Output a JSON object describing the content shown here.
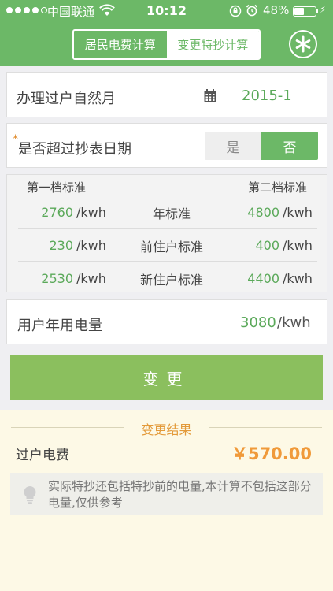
{
  "status_bar": {
    "carrier": "中国联通",
    "time": "10:12",
    "battery": "48%",
    "battery_level": 0.48
  },
  "nav": {
    "tabs": [
      {
        "label": "居民电费计算",
        "active": false
      },
      {
        "label": "变更特抄计算",
        "active": true
      }
    ],
    "action_icon": "asterisk-icon"
  },
  "form": {
    "transfer_month": {
      "label": "办理过户自然月",
      "value": "2015-1",
      "icon": "calendar-icon"
    },
    "over_read_date": {
      "label": "是否超过抄表日期",
      "required_mark": "*",
      "options": [
        "是",
        "否"
      ],
      "selected": "否"
    }
  },
  "standards": {
    "header_left": "第一档标准",
    "header_right": "第二档标准",
    "rows": [
      {
        "tier1": "2760",
        "tier1_unit": "/kwh",
        "name": "年标准",
        "tier2": "4800",
        "tier2_unit": "/kwh"
      },
      {
        "tier1": "230",
        "tier1_unit": "/kwh",
        "name": "前住户标准",
        "tier2": "400",
        "tier2_unit": "/kwh"
      },
      {
        "tier1": "2530",
        "tier1_unit": "/kwh",
        "name": "新住户标准",
        "tier2": "4400",
        "tier2_unit": "/kwh"
      }
    ]
  },
  "annual_usage": {
    "label": "用户年用电量",
    "value": "3080",
    "unit": "/kwh"
  },
  "change_button": "变更",
  "result": {
    "title": "变更结果",
    "fee_label": "过户电费",
    "fee_value": "￥570.00",
    "note": "实际特抄还包括特抄前的电量,本计算不包括这部分电量,仅供参考",
    "note_icon": "lightbulb-icon"
  },
  "colors": {
    "primary": "#6cb867",
    "button": "#8bbf5e",
    "value_green": "#5ba95a",
    "accent_orange": "#f09a3a",
    "result_bg": "#fdf9e6"
  }
}
